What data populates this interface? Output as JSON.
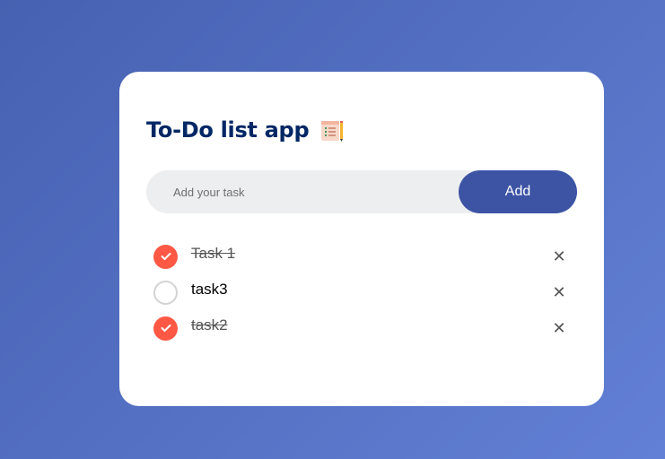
{
  "app": {
    "title": "To-Do list app",
    "title_icon": "notepad-checklist-icon"
  },
  "input": {
    "placeholder": "Add your task",
    "value": "",
    "add_label": "Add"
  },
  "tasks": [
    {
      "label": "Task 1",
      "checked": true
    },
    {
      "label": "task3",
      "checked": false
    },
    {
      "label": "task2",
      "checked": true
    }
  ],
  "colors": {
    "background_start": "#4761b2",
    "background_end": "#6280d6",
    "title": "#002765",
    "add_button": "#3d54a4",
    "checked": "#ff5945",
    "input_bg": "#edeef0"
  },
  "icons": {
    "delete": "close-icon",
    "check": "checkmark-icon"
  },
  "delete_glyph": "✕"
}
